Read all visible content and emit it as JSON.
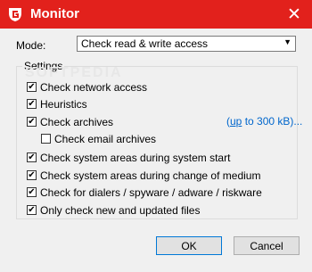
{
  "window": {
    "title": "Monitor",
    "close_glyph": "✕",
    "logo_icon": "g-data-logo"
  },
  "mode": {
    "label": "Mode:",
    "selected": "Check read & write access",
    "arrow": "▼"
  },
  "settings": {
    "title": "Settings",
    "watermark": "SOFTPEDIA",
    "options": [
      {
        "label": "Check network access",
        "checked": true
      },
      {
        "label": "Heuristics",
        "checked": true
      },
      {
        "label": "Check archives",
        "checked": true
      },
      {
        "label": "Check email archives",
        "checked": false
      },
      {
        "label": "Check system areas during system start",
        "checked": true
      },
      {
        "label": "Check system areas during change of medium",
        "checked": true
      },
      {
        "label": "Check for dialers / spyware / adware / riskware",
        "checked": true
      },
      {
        "label": "Only check new and updated files",
        "checked": true
      }
    ],
    "archive_limit_link_u": "up",
    "archive_limit_link_rest": " to 300 kB)..."
  },
  "buttons": {
    "ok": "OK",
    "cancel": "Cancel"
  },
  "check_glyph": "✔",
  "colors": {
    "titlebar": "#e2211c",
    "link": "#0066cc"
  }
}
